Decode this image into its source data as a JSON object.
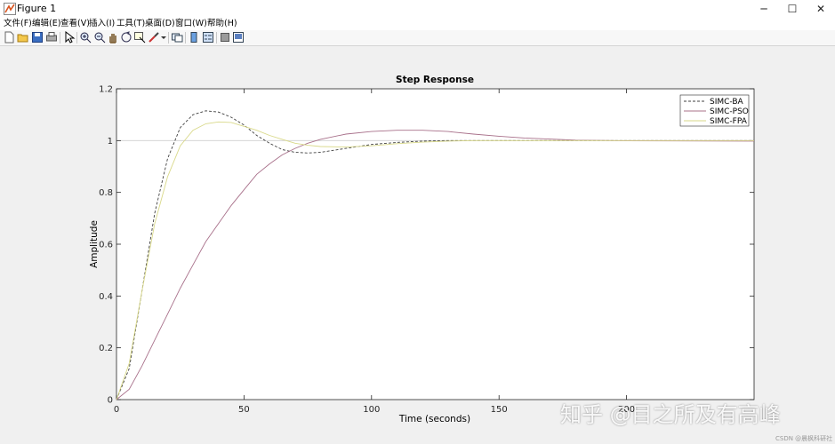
{
  "window": {
    "title": "Figure 1"
  },
  "menu": [
    "文件(F)",
    "编辑(E)",
    "查看(V)",
    "插入(I)",
    "工具(T)",
    "桌面(D)",
    "窗口(W)",
    "帮助(H)"
  ],
  "toolbar": {
    "icons": [
      "new-figure-icon",
      "open-file-icon",
      "save-icon",
      "print-icon",
      "pointer-icon",
      "zoom-in-icon",
      "zoom-out-icon",
      "pan-icon",
      "rotate-icon",
      "data-cursor-icon",
      "brush-icon",
      "link-plot-icon",
      "colorbar-icon",
      "legend-icon",
      "hide-plot-tools-icon",
      "show-plot-tools-icon"
    ]
  },
  "colors": {
    "SIMC-BA": "#404040",
    "SIMC-PSO": "#a8708a",
    "SIMC-FPA": "#d9d98a"
  },
  "chart_data": {
    "type": "line",
    "title": "Step Response",
    "xlabel": "Time (seconds)",
    "ylabel": "Amplitude",
    "xlim": [
      0,
      250
    ],
    "ylim": [
      0,
      1.2
    ],
    "xticks": [
      0,
      50,
      100,
      150,
      200
    ],
    "yticks": [
      0,
      0.2,
      0.4,
      0.6,
      0.8,
      1,
      1.2
    ],
    "ytick_labels": [
      "0",
      "0.2",
      "0.4",
      "0.6",
      "0.8",
      "1",
      "1.2"
    ],
    "reference_line": 1,
    "legend": {
      "position": "top-right",
      "entries": [
        "SIMC-BA",
        "SIMC-PSO",
        "SIMC-FPA"
      ]
    },
    "series": [
      {
        "name": "SIMC-BA",
        "style": "dashed",
        "x": [
          0,
          5,
          10,
          15,
          20,
          25,
          30,
          35,
          40,
          45,
          50,
          55,
          60,
          65,
          70,
          75,
          80,
          90,
          100,
          110,
          120,
          130,
          140,
          160,
          180,
          200,
          250
        ],
        "y": [
          0,
          0.12,
          0.42,
          0.72,
          0.93,
          1.05,
          1.1,
          1.115,
          1.11,
          1.09,
          1.06,
          1.02,
          0.99,
          0.965,
          0.955,
          0.952,
          0.955,
          0.97,
          0.985,
          0.993,
          0.998,
          1.0,
          1.0,
          1.0,
          1.0,
          1.0,
          1.0
        ]
      },
      {
        "name": "SIMC-PSO",
        "style": "solid",
        "x": [
          0,
          5,
          10,
          15,
          20,
          25,
          30,
          35,
          40,
          45,
          50,
          55,
          60,
          65,
          70,
          75,
          80,
          90,
          100,
          110,
          120,
          130,
          140,
          150,
          160,
          180,
          200,
          250
        ],
        "y": [
          0,
          0.04,
          0.13,
          0.23,
          0.33,
          0.43,
          0.52,
          0.61,
          0.68,
          0.75,
          0.81,
          0.87,
          0.91,
          0.945,
          0.97,
          0.99,
          1.005,
          1.025,
          1.035,
          1.04,
          1.04,
          1.035,
          1.025,
          1.017,
          1.01,
          1.002,
          0.999,
          0.998
        ]
      },
      {
        "name": "SIMC-FPA",
        "style": "solid",
        "x": [
          0,
          5,
          10,
          15,
          20,
          25,
          30,
          35,
          40,
          45,
          50,
          55,
          60,
          65,
          70,
          75,
          80,
          90,
          100,
          110,
          120,
          130,
          140,
          160,
          180,
          200,
          250
        ],
        "y": [
          0,
          0.14,
          0.42,
          0.68,
          0.86,
          0.98,
          1.04,
          1.065,
          1.072,
          1.07,
          1.055,
          1.04,
          1.02,
          1.005,
          0.99,
          0.982,
          0.977,
          0.975,
          0.98,
          0.988,
          0.994,
          0.998,
          1.0,
          1.0,
          1.0,
          1.0,
          1.0
        ]
      }
    ]
  },
  "watermark": {
    "text": "知乎 @目之所及有高峰",
    "small": "CSDN @晨枫科研社"
  }
}
